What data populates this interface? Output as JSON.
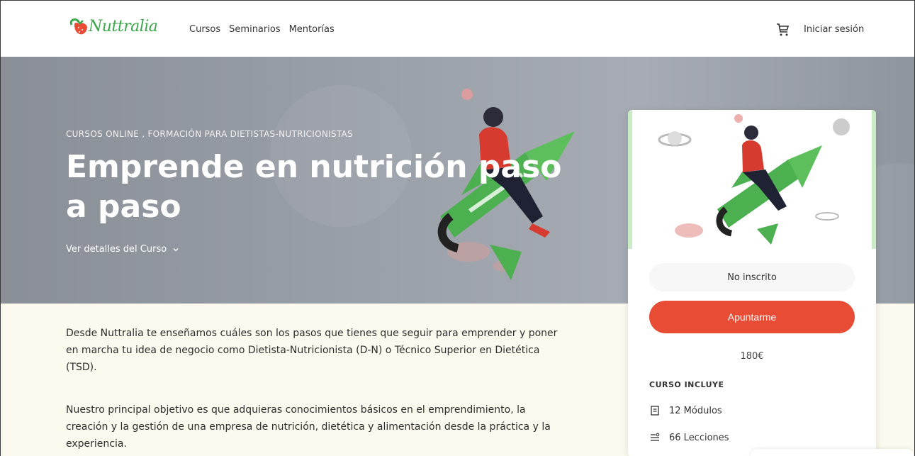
{
  "brand": {
    "logo_text": "Nuttralia"
  },
  "nav": {
    "items": [
      "Cursos",
      "Seminarios",
      "Mentorías"
    ]
  },
  "header": {
    "login_label": "Iniciar sesión"
  },
  "hero": {
    "categories": "CURSOS ONLINE ,  FORMACIÓN PARA DIETISTAS-NUTRICIONISTAS",
    "title": "Emprende en nutrición paso a paso",
    "details_label": "Ver detalles del Curso"
  },
  "content": {
    "paragraphs": [
      "Desde Nuttralia te enseñamos cuáles son los pasos que tienes que seguir para emprender y poner en marcha tu idea de negocio como Dietista-Nutricionista (D-N) o Técnico Superior en Dietética (TSD).",
      "Nuestro principal objetivo es que adquieras conocimientos básicos en el emprendimiento, la creación y la gestión de una empresa de nutrición, dietética y alimentación desde la práctica y la experiencia."
    ]
  },
  "card": {
    "status": "No inscrito",
    "enroll_label": "Apuntarme",
    "price": "180€",
    "includes_title": "CURSO INCLUYE",
    "includes": [
      {
        "icon": "book-icon",
        "label": "12 Módulos"
      },
      {
        "icon": "list-icon",
        "label": "66 Lecciones"
      }
    ]
  },
  "colors": {
    "accent": "#e84c35",
    "brand_green": "#3aa84a",
    "content_bg": "#fcfaef"
  }
}
